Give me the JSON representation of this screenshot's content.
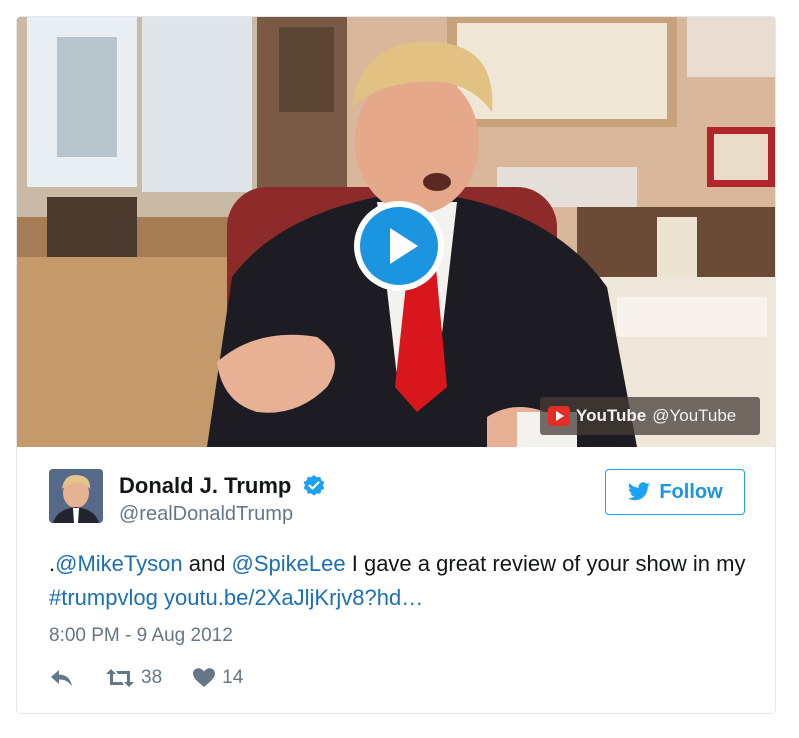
{
  "video": {
    "channel_brand": "YouTube",
    "channel_handle": "@YouTube"
  },
  "author": {
    "name": "Donald J. Trump",
    "handle": "@realDonaldTrump",
    "verified": true
  },
  "follow_button": {
    "label": "Follow"
  },
  "tweet": {
    "prefix": ".",
    "mention1": "@MikeTyson",
    "and": " and ",
    "mention2": "@SpikeLee",
    "text1": " I gave a great review of your show in my ",
    "hashtag": "#trumpvlog",
    "space": " ",
    "url": "youtu.be/2XaJljKrjv8?hd…"
  },
  "timestamp": "8:00 PM - 9 Aug 2012",
  "actions": {
    "retweets": "38",
    "likes": "14"
  },
  "colors": {
    "twitter_blue": "#1da1f2",
    "link": "#1b6fb5",
    "play_button": "#1b95e0",
    "youtube_red": "#e52d27"
  },
  "icons": [
    "play-icon",
    "youtube-logo-icon",
    "verified-badge-icon",
    "twitter-bird-icon",
    "reply-icon",
    "retweet-icon",
    "heart-icon"
  ]
}
